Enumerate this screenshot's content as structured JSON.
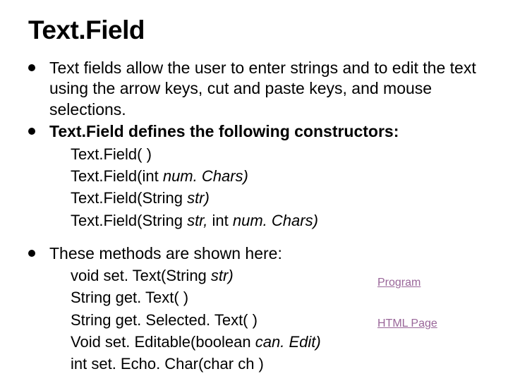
{
  "title": "Text.Field",
  "bullets": {
    "b1": "Text fields allow the user to enter strings and to edit the text using the arrow keys, cut and paste keys, and mouse selections.",
    "b2": "Text.Field defines the following constructors:",
    "b3": "These methods are shown here:"
  },
  "constructors": {
    "c1": "Text.Field( )",
    "c2_pre": "Text.Field(int ",
    "c2_it": "num. Chars)",
    "c3_pre": "Text.Field(String ",
    "c3_it": "str)",
    "c4_pre": "Text.Field(String ",
    "c4_it1": "str, ",
    "c4_mid": "int ",
    "c4_it2": "num. Chars)"
  },
  "methods": {
    "m1_pre": "void set. Text(String ",
    "m1_it": "str)",
    "m2": "String get. Text( )",
    "m3": "String get. Selected. Text( )",
    "m4_pre": "Void set. Editable(boolean ",
    "m4_it": "can. Edit)",
    "m5": "int set. Echo. Char(char ch )"
  },
  "links": {
    "program": "Program",
    "htmlpage": "HTML Page"
  }
}
